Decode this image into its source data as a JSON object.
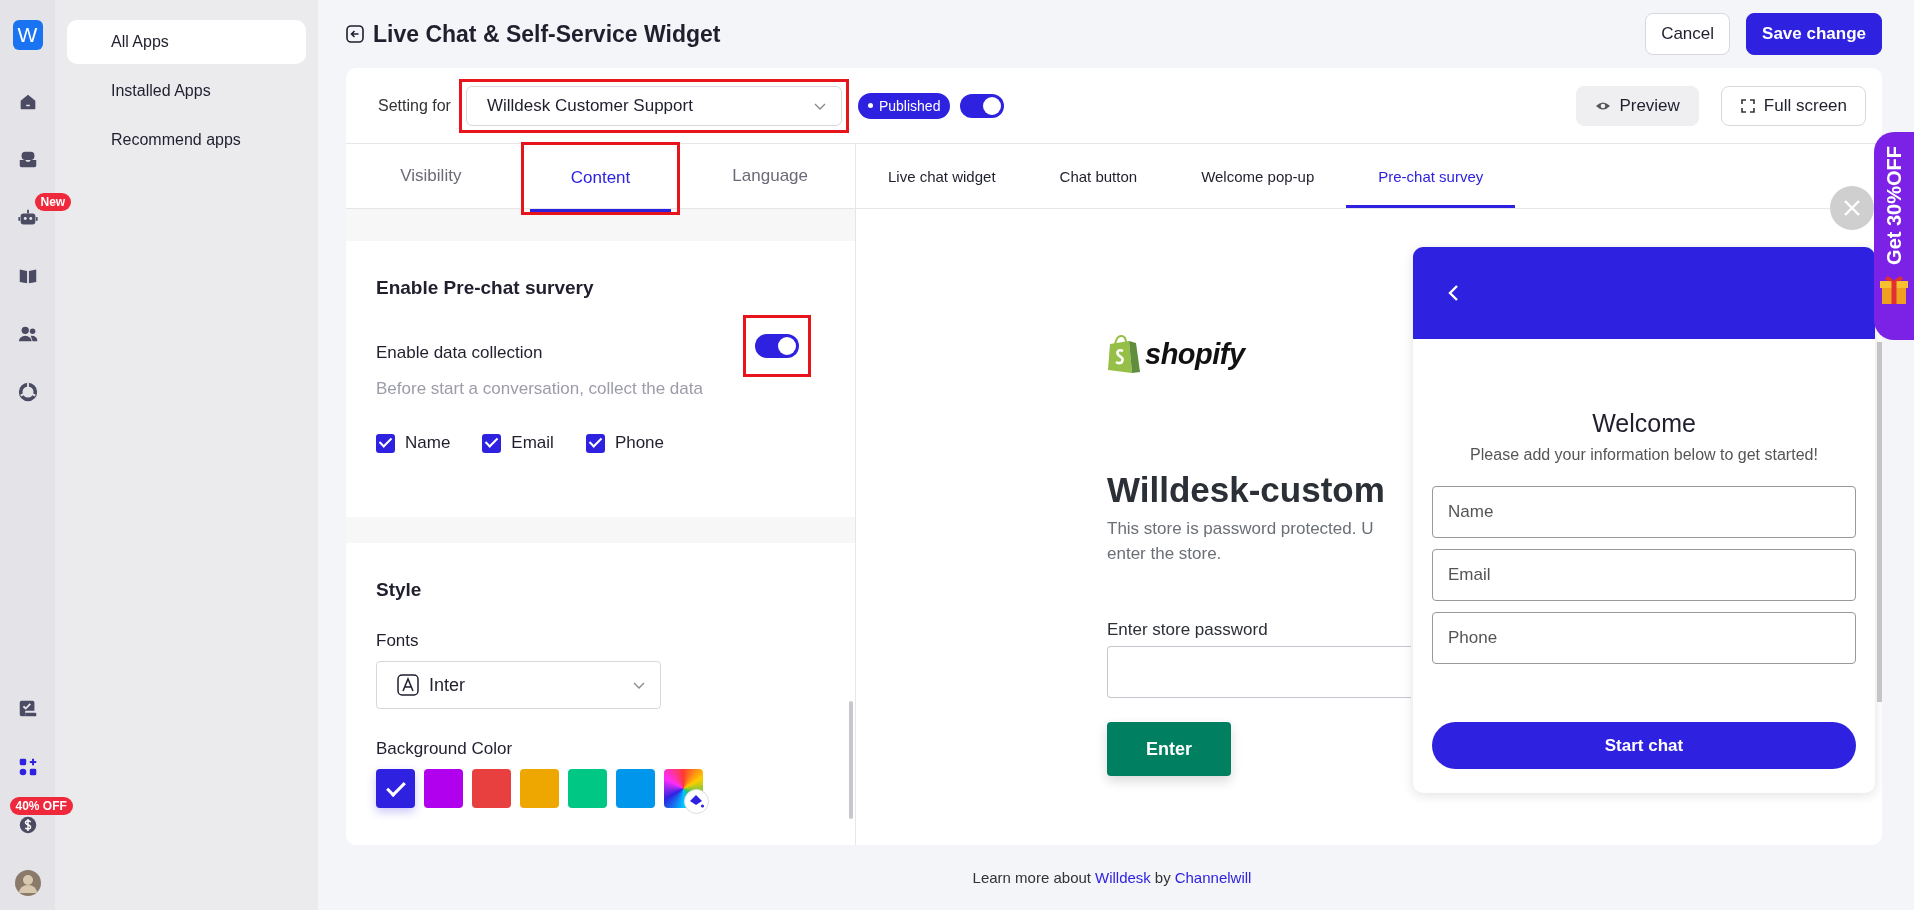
{
  "rail": {
    "logo": "W",
    "items": [
      {
        "selected": false
      },
      {
        "selected": false
      },
      {
        "selected": false,
        "badge": "New"
      },
      {
        "selected": false
      },
      {
        "selected": false
      },
      {
        "selected": false
      }
    ],
    "bottom_items": [
      {
        "selected": false
      },
      {
        "selected": true
      },
      {
        "selected": false,
        "badge": "40% OFF"
      }
    ]
  },
  "nav": [
    {
      "label": "All Apps",
      "selected": true
    },
    {
      "label": "Installed Apps",
      "selected": false
    },
    {
      "label": "Recommend apps",
      "selected": false
    }
  ],
  "header": {
    "title": "Live Chat & Self-Service Widget",
    "buttons": [
      {
        "label": "Cancel",
        "kind": "secondary"
      },
      {
        "label": "Save change",
        "kind": "primary"
      }
    ]
  },
  "settings_bar": {
    "label": "Setting for",
    "select": {
      "value": "Willdesk Customer Support",
      "highlighted": true
    },
    "status": "Published",
    "published": true,
    "actions": [
      {
        "label": "Preview",
        "kind": "preview"
      },
      {
        "label": "Full screen",
        "kind": "fullscreen"
      }
    ]
  },
  "left_tabs": [
    {
      "label": "Visibility",
      "selected": false,
      "highlighted": false
    },
    {
      "label": "Content",
      "selected": true,
      "highlighted": true
    },
    {
      "label": "Language",
      "selected": false,
      "highlighted": false
    }
  ],
  "survey": {
    "title": "Enable Pre-chat survery",
    "toggle": {
      "label": "Enable data collection",
      "on": true,
      "highlighted": true
    },
    "hint": "Before start a conversation, collect the data",
    "fields": [
      {
        "label": "Name",
        "checked": true
      },
      {
        "label": "Email",
        "checked": true
      },
      {
        "label": "Phone",
        "checked": true
      }
    ]
  },
  "style": {
    "title": "Style",
    "font_label": "Fonts",
    "font": "Inter",
    "color_label": "Background Color",
    "colors": [
      {
        "kind": "swatch",
        "color": "#2e22e0",
        "selected": true
      },
      {
        "kind": "swatch",
        "color": "#b000ee",
        "selected": false
      },
      {
        "kind": "swatch",
        "color": "#e8403f",
        "selected": false
      },
      {
        "kind": "swatch",
        "color": "#eea600",
        "selected": false
      },
      {
        "kind": "swatch",
        "color": "#00c884",
        "selected": false
      },
      {
        "kind": "swatch",
        "color": "#0096ec",
        "selected": false
      },
      {
        "kind": "picker",
        "selected": false
      }
    ]
  },
  "preview_tabs": [
    {
      "label": "Live chat widget",
      "selected": false
    },
    {
      "label": "Chat button",
      "selected": false
    },
    {
      "label": "Welcome pop-up",
      "selected": false
    },
    {
      "label": "Pre-chat survey",
      "selected": true
    }
  ],
  "store": {
    "logo": "shopify",
    "title": "Willdesk-custom",
    "text_lines": [
      "This store is password protected. U",
      "enter the store."
    ],
    "password_label": "Enter store password",
    "button": "Enter"
  },
  "widget": {
    "title": "Welcome",
    "subtitle": "Please add your information below to get started!",
    "fields": [
      {
        "placeholder": "Name"
      },
      {
        "placeholder": "Email"
      },
      {
        "placeholder": "Phone"
      }
    ],
    "button": "Start chat"
  },
  "promo": {
    "label": "Get 30%OFF"
  },
  "footer": {
    "prefix": "Learn more about",
    "brand": "Willdesk",
    "by": "by",
    "company": "Channelwill"
  }
}
